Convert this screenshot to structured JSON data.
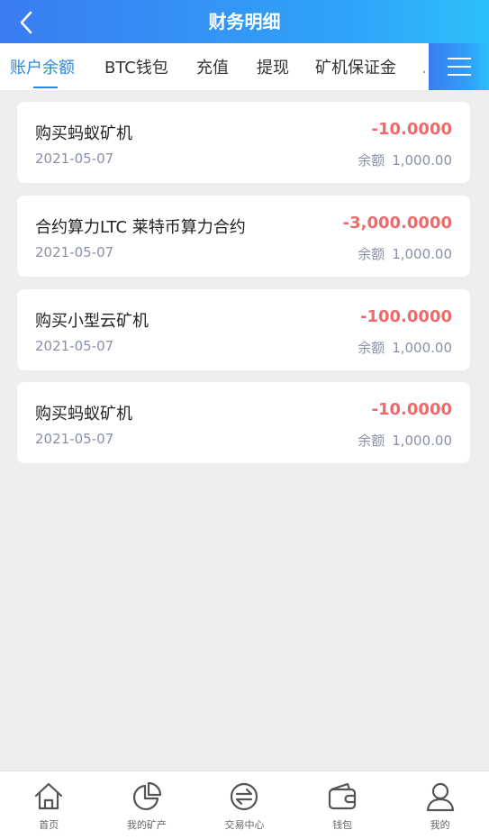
{
  "header": {
    "title": "财务明细"
  },
  "tabs": [
    {
      "label": "账户余额",
      "active": true
    },
    {
      "label": "BTC钱包",
      "active": false
    },
    {
      "label": "充值",
      "active": false
    },
    {
      "label": "提现",
      "active": false
    },
    {
      "label": "矿机保证金",
      "active": false
    },
    {
      "label": "…",
      "active": false
    }
  ],
  "colors": {
    "accent": "#2a86e6",
    "negative": "#ef6a6a",
    "muted": "#8a8fa8"
  },
  "records": [
    {
      "name": "购买蚂蚁矿机",
      "date": "2021-05-07",
      "amount": "-10.0000",
      "balance_label": "余额",
      "balance": "1,000.00"
    },
    {
      "name": "合约算力LTC 莱特币算力合约",
      "date": "2021-05-07",
      "amount": "-3,000.0000",
      "balance_label": "余额",
      "balance": "1,000.00"
    },
    {
      "name": "购买小型云矿机",
      "date": "2021-05-07",
      "amount": "-100.0000",
      "balance_label": "余额",
      "balance": "1,000.00"
    },
    {
      "name": "购买蚂蚁矿机",
      "date": "2021-05-07",
      "amount": "-10.0000",
      "balance_label": "余额",
      "balance": "1,000.00"
    }
  ],
  "tabbar": [
    {
      "label": "首页",
      "icon": "home-icon"
    },
    {
      "label": "我的矿产",
      "icon": "pie-chart-icon"
    },
    {
      "label": "交易中心",
      "icon": "exchange-icon"
    },
    {
      "label": "钱包",
      "icon": "wallet-icon"
    },
    {
      "label": "我的",
      "icon": "user-icon"
    }
  ]
}
